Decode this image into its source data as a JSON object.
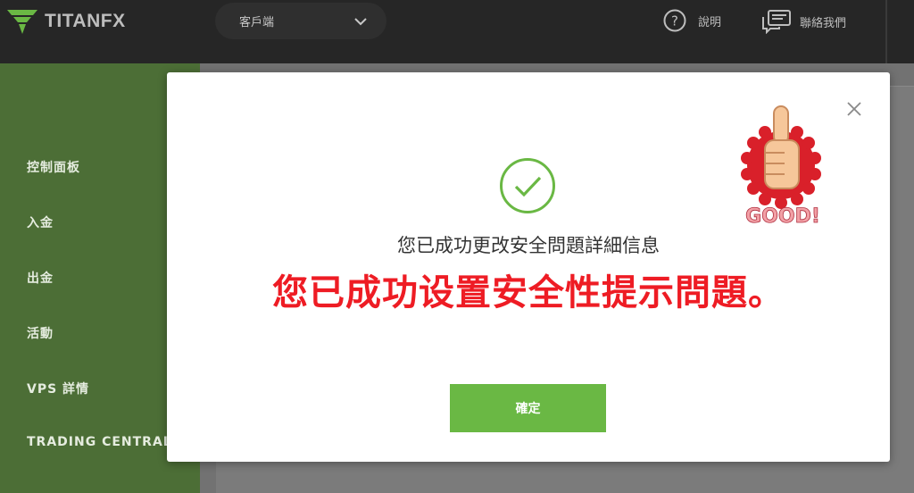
{
  "header": {
    "logo_text": "TITANFX",
    "client_select": {
      "value": "客戶端"
    },
    "help_label": "說明",
    "contact_label": "聯絡我們"
  },
  "sidebar": {
    "items": [
      {
        "label": "控制面板"
      },
      {
        "label": "入金"
      },
      {
        "label": "出金"
      },
      {
        "label": "活動"
      },
      {
        "label": "VPS 詳情"
      },
      {
        "label": "TRADING CENTRAL"
      }
    ]
  },
  "modal": {
    "message": "您已成功更改安全問題詳細信息",
    "annotation": "您已成功设置安全性提示問題。",
    "sticker_text": "GOOD!",
    "confirm_label": "確定"
  },
  "colors": {
    "topbar_bg": "#262626",
    "sidebar_bg": "#4c6e36",
    "accent_green": "#6ab844",
    "annotation_red": "#ee1c24"
  },
  "icons": [
    "titanfx-logo-icon",
    "chevron-down-icon",
    "help-icon",
    "chat-icon",
    "close-icon",
    "check-circle-icon",
    "thumbs-up-sticker"
  ]
}
